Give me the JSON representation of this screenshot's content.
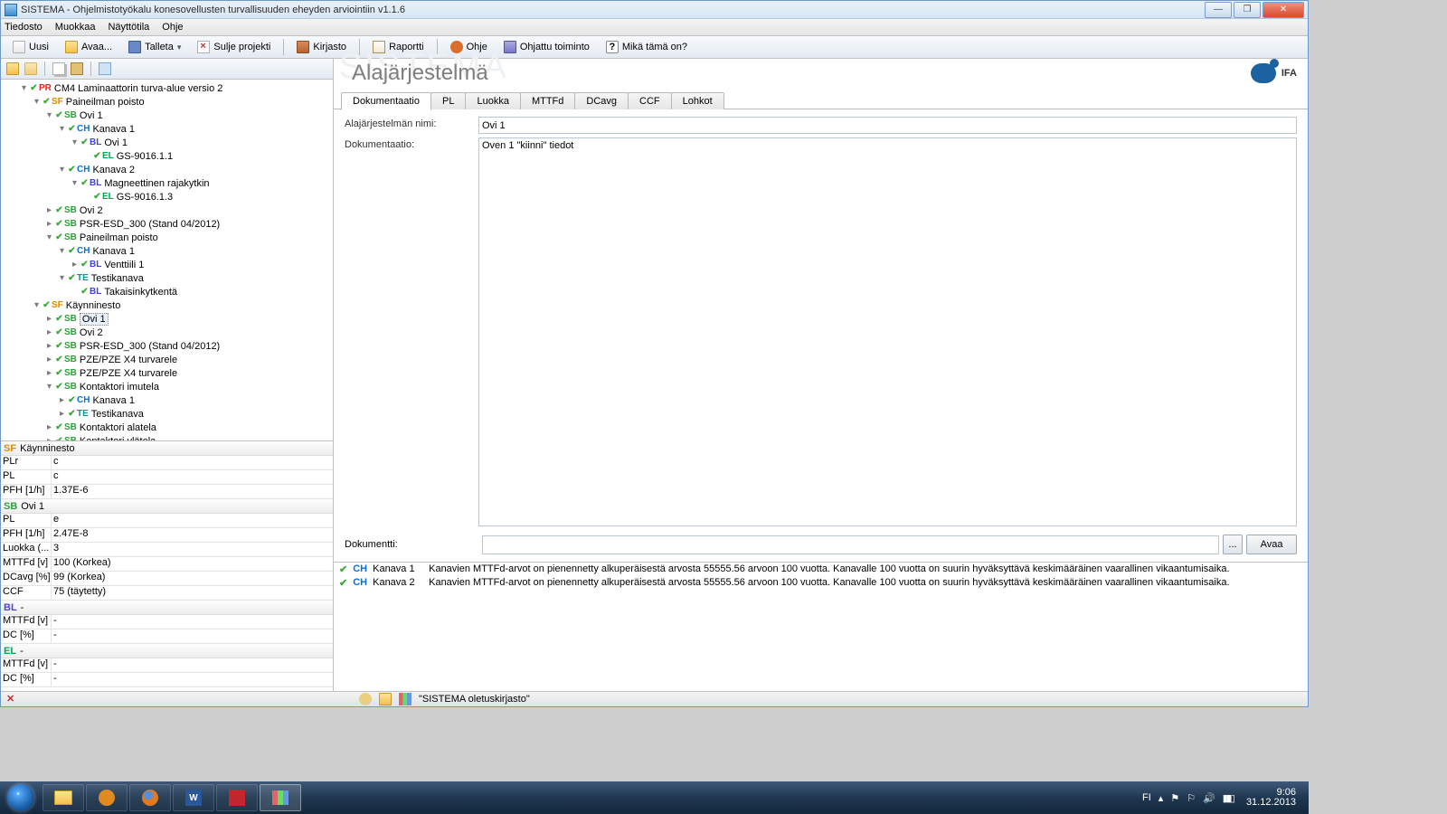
{
  "title": "SISTEMA - Ohjelmistotyökalu konesovellusten turvallisuuden eheyden arviointiin v1.1.6",
  "menu": {
    "file": "Tiedosto",
    "edit": "Muokkaa",
    "view": "Näyttötila",
    "help": "Ohje"
  },
  "toolbar": {
    "new": "Uusi",
    "open": "Avaa...",
    "save": "Talleta",
    "close": "Sulje projekti",
    "library": "Kirjasto",
    "report": "Raportti",
    "helpbtn": "Ohje",
    "wizard": "Ohjattu toiminto",
    "whats": "Mikä tämä on?"
  },
  "tree": [
    {
      "ind": 1,
      "exp": "▾",
      "tag": "PR",
      "t": "CM4 Laminaattorin turva-alue versio 2"
    },
    {
      "ind": 2,
      "exp": "▾",
      "tag": "SF",
      "t": "Paineilman poisto"
    },
    {
      "ind": 3,
      "exp": "▾",
      "tag": "SB",
      "t": "Ovi 1"
    },
    {
      "ind": 4,
      "exp": "▾",
      "tag": "CH",
      "t": "Kanava 1"
    },
    {
      "ind": 5,
      "exp": "▾",
      "tag": "BL",
      "t": "Ovi 1"
    },
    {
      "ind": 6,
      "exp": "",
      "tag": "EL",
      "t": "GS-9016.1.1"
    },
    {
      "ind": 4,
      "exp": "▾",
      "tag": "CH",
      "t": "Kanava 2"
    },
    {
      "ind": 5,
      "exp": "▾",
      "tag": "BL",
      "t": "Magneettinen rajakytkin"
    },
    {
      "ind": 6,
      "exp": "",
      "tag": "EL",
      "t": "GS-9016.1.3"
    },
    {
      "ind": 3,
      "exp": "▸",
      "tag": "SB",
      "t": "Ovi 2"
    },
    {
      "ind": 3,
      "exp": "▸",
      "tag": "SB",
      "t": "PSR-ESD_300 (Stand 04/2012)"
    },
    {
      "ind": 3,
      "exp": "▾",
      "tag": "SB",
      "t": "Paineilman poisto"
    },
    {
      "ind": 4,
      "exp": "▾",
      "tag": "CH",
      "t": "Kanava 1"
    },
    {
      "ind": 5,
      "exp": "▸",
      "tag": "BL",
      "t": "Venttiili 1"
    },
    {
      "ind": 4,
      "exp": "▾",
      "tag": "TE",
      "t": "Testikanava"
    },
    {
      "ind": 5,
      "exp": "",
      "tag": "BL",
      "t": "Takaisinkytkentä"
    },
    {
      "ind": 2,
      "exp": "▾",
      "tag": "SF",
      "t": "Käynninesto"
    },
    {
      "ind": 3,
      "exp": "▸",
      "tag": "SB",
      "t": "Ovi 1",
      "sel": true
    },
    {
      "ind": 3,
      "exp": "▸",
      "tag": "SB",
      "t": "Ovi 2"
    },
    {
      "ind": 3,
      "exp": "▸",
      "tag": "SB",
      "t": "PSR-ESD_300 (Stand 04/2012)"
    },
    {
      "ind": 3,
      "exp": "▸",
      "tag": "SB",
      "t": "PZE/PZE X4  turvarele"
    },
    {
      "ind": 3,
      "exp": "▸",
      "tag": "SB",
      "t": "PZE/PZE X4  turvarele"
    },
    {
      "ind": 3,
      "exp": "▾",
      "tag": "SB",
      "t": "Kontaktori imutela"
    },
    {
      "ind": 4,
      "exp": "▸",
      "tag": "CH",
      "t": "Kanava 1"
    },
    {
      "ind": 4,
      "exp": "▸",
      "tag": "TE",
      "t": "Testikanava"
    },
    {
      "ind": 3,
      "exp": "▸",
      "tag": "SB",
      "t": "Kontaktori alatela"
    },
    {
      "ind": 3,
      "exp": "▸",
      "tag": "SB",
      "t": "Kontaktori ylätela"
    }
  ],
  "props": [
    {
      "hdr": true,
      "tag": "SF",
      "title": "Käynninesto",
      "color": "#e08a00"
    },
    {
      "k": "PLr",
      "v": "c"
    },
    {
      "k": "PL",
      "v": "c"
    },
    {
      "k": "PFH [1/h]",
      "v": "1.37E-6"
    },
    {
      "hdr": true,
      "tag": "SB",
      "title": "Ovi 1",
      "color": "#2d9f3a"
    },
    {
      "k": "PL",
      "v": "e"
    },
    {
      "k": "PFH [1/h]",
      "v": "2.47E-8"
    },
    {
      "k": "Luokka (...",
      "v": "3"
    },
    {
      "k": "MTTFd [v]",
      "v": "100 (Korkea)"
    },
    {
      "k": "DCavg [%]",
      "v": "99 (Korkea)"
    },
    {
      "k": "CCF",
      "v": "75 (täytetty)"
    },
    {
      "hdr": true,
      "tag": "BL",
      "title": "-",
      "color": "#4743d6"
    },
    {
      "k": "MTTFd [v]",
      "v": "-"
    },
    {
      "k": "DC [%]",
      "v": "-"
    },
    {
      "hdr": true,
      "tag": "EL",
      "title": "-",
      "color": "#00a651"
    },
    {
      "k": "MTTFd [v]",
      "v": "-"
    },
    {
      "k": "DC [%]",
      "v": "-"
    }
  ],
  "header": {
    "bg": "SISTEMA",
    "h1": "Alajärjestelmä",
    "logo": "IFA"
  },
  "tabs": [
    "Dokumentaatio",
    "PL",
    "Luokka",
    "MTTFd",
    "DCavg",
    "CCF",
    "Lohkot"
  ],
  "form": {
    "name_lbl": "Alajärjestelmän nimi:",
    "name_val": "Ovi 1",
    "doc_lbl": "Dokumentaatio:",
    "doc_val": "Oven 1 \"kiinni\" tiedot",
    "file_lbl": "Dokumentti:",
    "file_val": "",
    "browse": "...",
    "open": "Avaa"
  },
  "messages": [
    {
      "tag": "CH",
      "lbl": "Kanava 1",
      "txt": "Kanavien MTTFd-arvot on pienennetty alkuperäisestä arvosta 55555.56 arvoon 100 vuotta. Kanavalle 100 vuotta on suurin hyväksyttävä keskimääräinen vaarallinen vikaantumisaika."
    },
    {
      "tag": "CH",
      "lbl": "Kanava 2",
      "txt": "Kanavien MTTFd-arvot on pienennetty alkuperäisestä arvosta 55555.56 arvoon 100 vuotta. Kanavalle 100 vuotta on suurin hyväksyttävä keskimääräinen vaarallinen vikaantumisaika."
    }
  ],
  "status": {
    "text": "\"SISTEMA oletuskirjasto\""
  },
  "tray": {
    "lang": "FI",
    "time": "9:06",
    "date": "31.12.2013"
  }
}
